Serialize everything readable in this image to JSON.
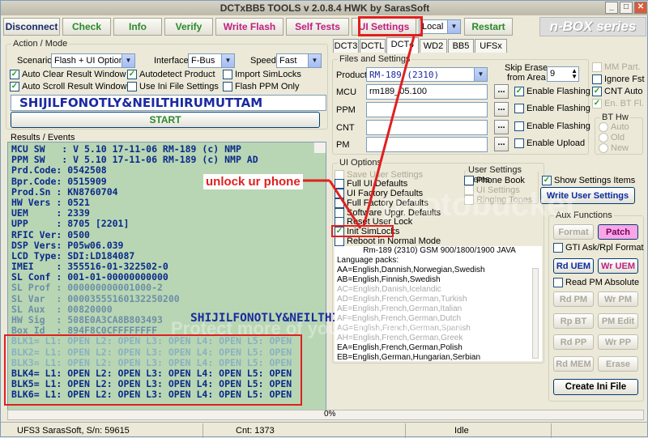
{
  "window": {
    "title": "DCTxBB5 TOOLS v 2.0.8.4 HWK by SarasSoft"
  },
  "toolbar": {
    "disconnect": "Disconnect",
    "check": "Check",
    "info": "Info",
    "verify": "Verify",
    "write_flash": "Write Flash",
    "self_tests": "Self Tests",
    "ui_settings": "UI Settings",
    "mode_select": "Local",
    "restart": "Restart",
    "brand": "n-BOX series"
  },
  "colors": {
    "green_label": "#2a8a2a",
    "blue_label": "#1a3aa0",
    "pink_label": "#c02080",
    "annotation_red": "#e02020"
  },
  "action_mode": {
    "group_label": "Action / Mode",
    "scenario_label": "Scenario",
    "scenario_value": "Flash + UI Options",
    "interface_label": "Interface",
    "interface_value": "F-Bus",
    "speed_label": "Speed",
    "speed_value": "Fast",
    "checkboxes": [
      {
        "label": "Auto Clear Result Window",
        "checked": "true"
      },
      {
        "label": "Autodetect Product",
        "checked": "true"
      },
      {
        "label": "Import SimLocks",
        "checked": "false"
      },
      {
        "label": "Auto Scroll Result Window",
        "checked": "true"
      },
      {
        "label": "Use Ini File Settings",
        "checked": "false"
      },
      {
        "label": "Flash PPM Only",
        "checked": "false"
      }
    ],
    "banner": "SHIJILFONOTLY&NEILTHIRUMUTTAM",
    "start": "START"
  },
  "results": {
    "label": "Results / Events",
    "lines": [
      "MCU SW   : V 5.10 17-11-06 RM-189 (c) NMP",
      "PPM SW   : V 5.10 17-11-06 RM-189 (c) NMP AD",
      "Prd.Code: 0542508",
      "Bpr.Code: 0515909",
      "Prod.Sn : KN8760704",
      "HW Vers : 0521",
      "UEM     : 2339",
      "UPP     : 8705 [2201]",
      "RFIC Ver: 0500",
      "DSP Vers: P05w06.039",
      "LCD Type: SDI:LD184087",
      "IMEI    : 355516-01-322502-0",
      "SL Conf : 001-01-00000000000",
      "SL Prof : 000000000001000-2",
      "SL Var  : 00003555160132250200",
      "SL Aux  : 00820000",
      "HW Sig  : 508E0A3CA8B803493",
      "Box Id  : 894F8C0CFFFFFFFF"
    ],
    "blk_lines": [
      "BLK1= L1: OPEN L2: OPEN L3: OPEN L4: OPEN L5: OPEN",
      "BLK2= L1: OPEN L2: OPEN L3: OPEN L4: OPEN L5: OPEN",
      "BLK3= L1: OPEN L2: OPEN L3: OPEN L4: OPEN L5: OPEN",
      "BLK4= L1: OPEN L2: OPEN L3: OPEN L4: OPEN L5: OPEN",
      "BLK5= L1: OPEN L2: OPEN L3: OPEN L4: OPEN L5: OPEN",
      "BLK6= L1: OPEN L2: OPEN L3: OPEN L4: OPEN L5: OPEN"
    ],
    "overlay_name": "SHIJILFONOTLY&NEILTHIRUMUTTAM",
    "annotation": "unlock ur phone"
  },
  "tabs": {
    "row1": [
      "DCT3",
      "DCTL",
      "DCT4",
      "WD2",
      "BB5",
      "UFSx"
    ],
    "active": "DCT4"
  },
  "files": {
    "group_label": "Files and Settings",
    "product_label": "Product",
    "product_value": "RM-189 (2310)",
    "skip_erase_label_1": "Skip Erase",
    "skip_erase_label_2": "from Area",
    "skip_value": "9",
    "mcu_label": "MCU",
    "mcu_value": "rm189_05.100",
    "ppm_label": "PPM",
    "cnt_label": "CNT",
    "pm_label": "PM",
    "dots": "...",
    "enable_flashing_1": "Enable Flashing",
    "enable_flashing_2": "Enable Flashing",
    "enable_flashing_3": "Enable Flashing",
    "enable_upload": "Enable Upload",
    "mm_part": "MM Part.",
    "ignore_fst": "Ignore Fst",
    "cnt_auto": "CNT Auto",
    "en_bt_fl": "En. BT Fl.",
    "bt_hw_label": "BT Hw",
    "bt_auto": "Auto",
    "bt_old": "Old",
    "bt_new": "New"
  },
  "ui_options": {
    "group_label": "UI Options",
    "items": [
      {
        "label": "Save User Settings",
        "checked": "false"
      },
      {
        "label": "Full UI Defaults",
        "checked": "false"
      },
      {
        "label": "UI Factory Defaults",
        "checked": "false"
      },
      {
        "label": "Full Factory Defaults",
        "checked": "false"
      },
      {
        "label": "Software Upgr. Defaults",
        "checked": "false"
      },
      {
        "label": "Reset User Lock",
        "checked": "false"
      },
      {
        "label": "Init SimLocks",
        "checked": "true"
      },
      {
        "label": "Reboot in Normal Mode",
        "checked": "false"
      }
    ],
    "product_line": "Rm-189 (2310) GSM 900/1800/1900 JAVA",
    "lang_title": "Language packs:",
    "langs": [
      "AA=English,Dannish,Norwegian,Swedish",
      "AB=English,Finnish,Swedish",
      "AC=English,Danish,Icelandic",
      "AD=English,French,German,Turkish",
      "AE=English,French,German,Italian",
      "AF=English,French,German,Dutch",
      "AG=English,French,German,Spanish",
      "AH=English,French,German,Greek",
      "EA=English,French,German,Polish",
      "EB=English,German,Hungarian,Serbian"
    ]
  },
  "user_settings": {
    "group_label": "User Settings Items",
    "phone_book": "Phone Book",
    "ui_settings": "UI Settings",
    "ringing_tones": "Ringing Tones",
    "show_settings": "Show Settings Items",
    "write_user_settings": "Write User Settings"
  },
  "aux": {
    "group_label": "Aux Functions",
    "format": "Format",
    "patch": "Patch",
    "gti": "GTI Ask/Rpl Format",
    "rd_uem": "Rd UEM",
    "wr_uem": "Wr UEM",
    "read_pm_abs": "Read PM Absolute",
    "rd_pm": "Rd PM",
    "wr_pm": "Wr PM",
    "rp_bt": "Rp BT",
    "pm_edit": "PM Edit",
    "rd_pp": "Rd PP",
    "wr_pp": "Wr PP",
    "rd_mem": "Rd MEM",
    "erase": "Erase",
    "create_ini": "Create Ini File"
  },
  "progress": {
    "percent": "0%",
    "value": 0
  },
  "status": {
    "left": "UFS3 SarasSoft, S/n: 59615",
    "cnt": "Cnt: 1373",
    "state": "Idle"
  },
  "watermark": "Protect more of your memories for less!"
}
